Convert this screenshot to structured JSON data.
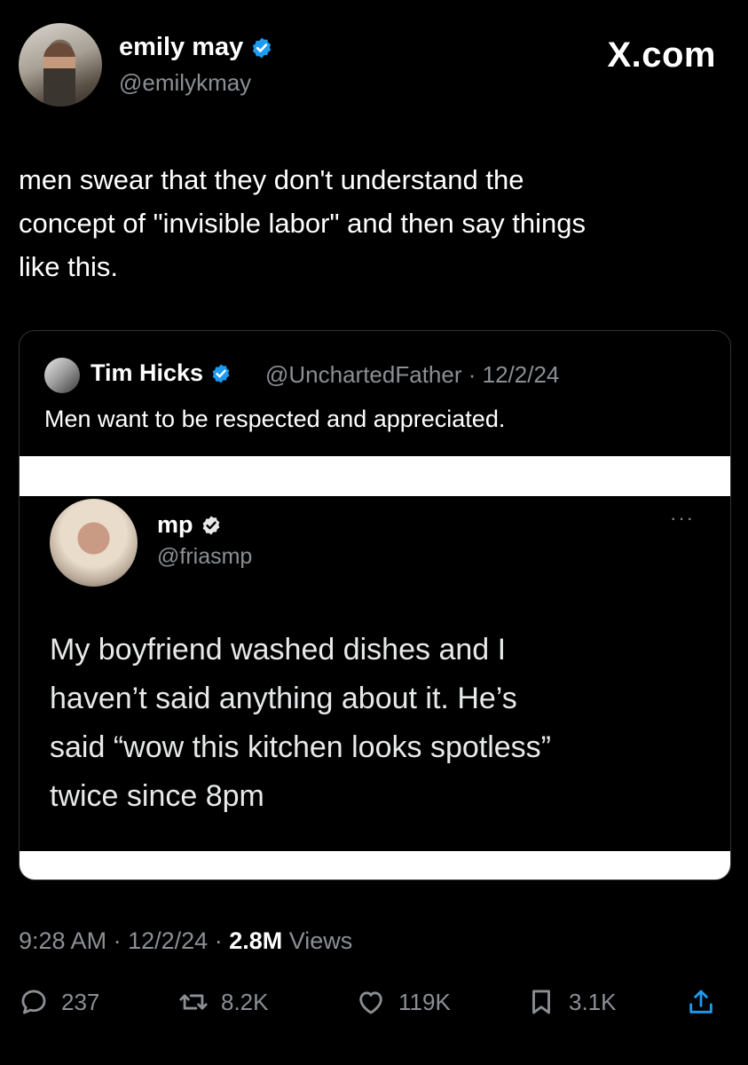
{
  "author": {
    "name": "emily may",
    "handle": "@emilykmay"
  },
  "site": "X.com",
  "post": {
    "text_lines": [
      "men swear that they don't understand the",
      "concept of \"invisible labor\" and then say things",
      "like this."
    ]
  },
  "quote": {
    "name": "Tim Hicks",
    "handle": "@UnchartedFather",
    "sep": "·",
    "date": "12/2/24",
    "text": "Men want to be respected and appreciated."
  },
  "inner_tweet": {
    "name": "mp",
    "handle": "@friasmp",
    "more": "···",
    "text_lines": [
      "My boyfriend washed dishes and I",
      "haven’t said anything about it. He’s",
      "said “wow this kitchen looks spotless”",
      "twice since 8pm"
    ]
  },
  "meta": {
    "time": "9:28 AM",
    "sep": "·",
    "date": "12/2/24",
    "views_count": "2.8M",
    "views_label": "Views"
  },
  "actions": {
    "replies": "237",
    "reposts": "8.2K",
    "likes": "119K",
    "bookmarks": "3.1K"
  },
  "colors": {
    "verified": "#1d9bf0",
    "background": "#000000",
    "muted": "#8b8f94"
  }
}
